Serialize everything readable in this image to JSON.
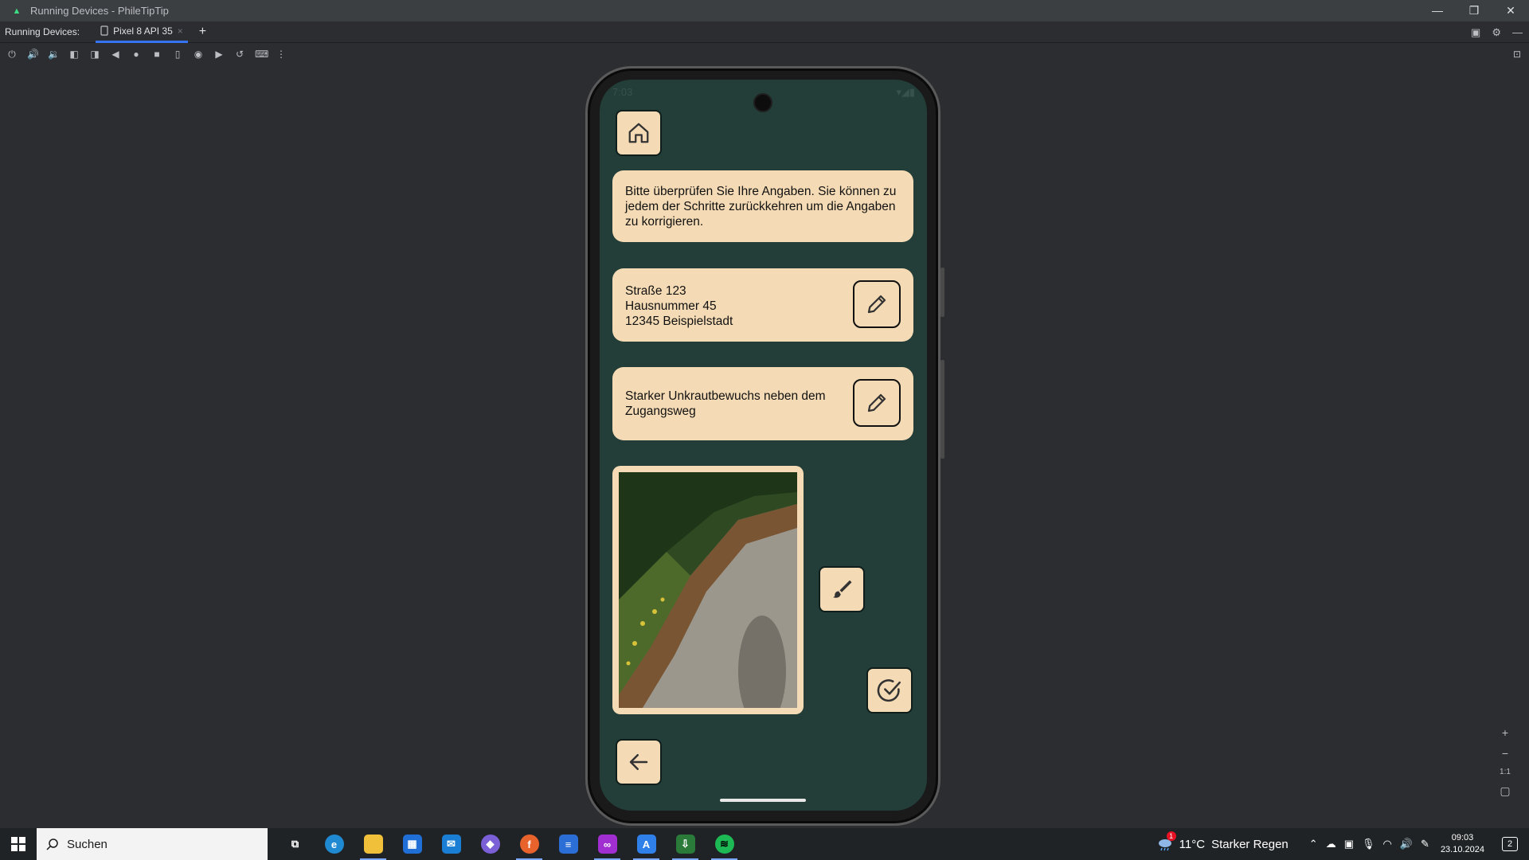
{
  "window": {
    "title": "Running Devices - PhileTipTip",
    "minimize": "—",
    "restore": "❐",
    "close": "✕"
  },
  "tabbar": {
    "label": "Running Devices:",
    "tab_label": "Pixel 8 API 35",
    "tab_close": "×",
    "add": "+"
  },
  "phone": {
    "status_time": "7:03",
    "intro_text": "Bitte überprüfen Sie Ihre Angaben. Sie können zu jedem der Schritte zurückkehren um die Angaben zu korrigieren.",
    "address_line1": "Straße 123",
    "address_line2": "Hausnummer 45",
    "address_line3": "12345 Beispielstadt",
    "description": "Starker Unkrautbewuchs neben dem Zugangsweg"
  },
  "zoom": {
    "plus": "+",
    "minus": "−",
    "one_to_one": "1:1"
  },
  "taskbar": {
    "search_placeholder": "Suchen",
    "weather_temp": "11°C",
    "weather_text": "Starker Regen",
    "weather_badge": "1",
    "time": "09:03",
    "date": "23.10.2024",
    "notification_count": "2"
  }
}
